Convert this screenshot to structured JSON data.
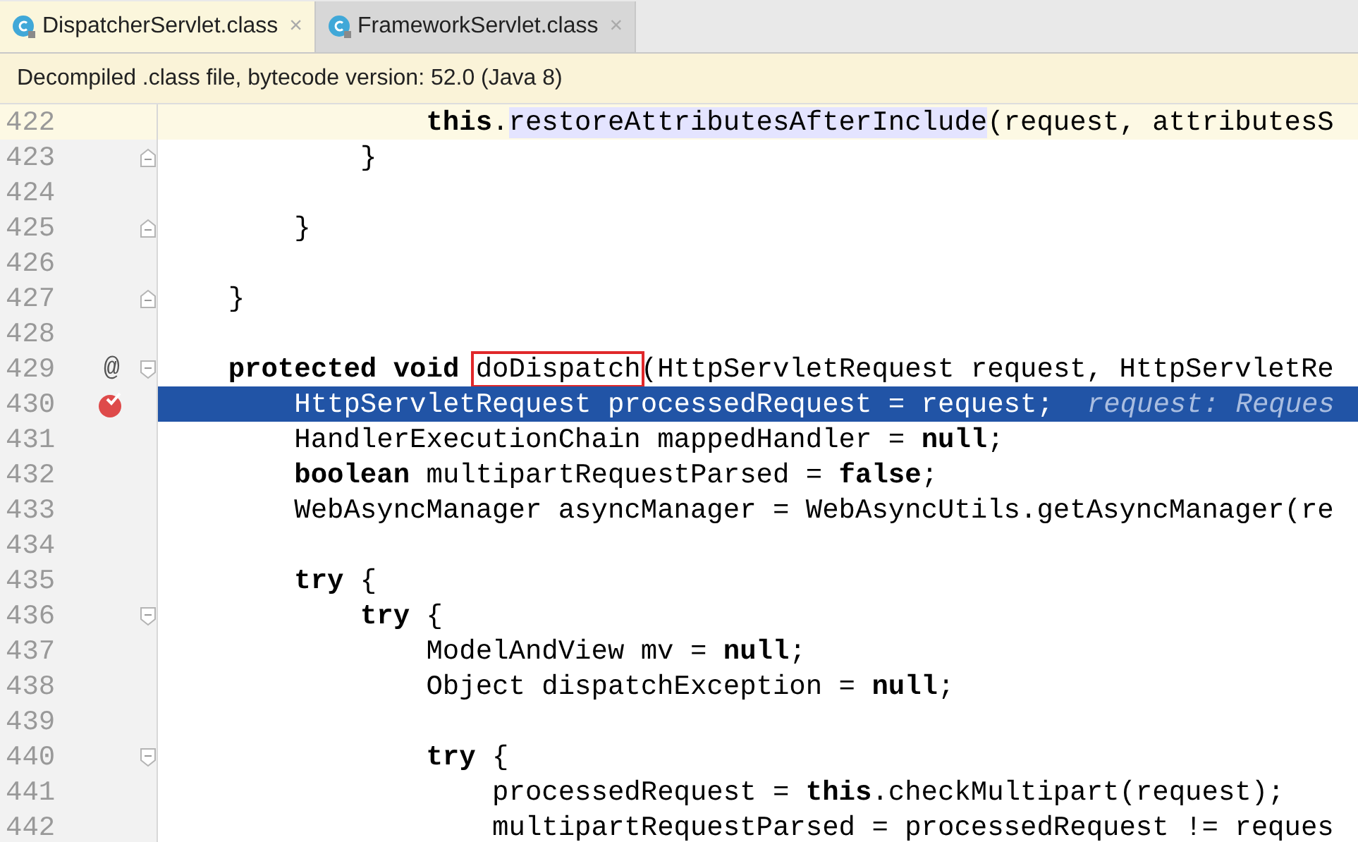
{
  "tabs": [
    {
      "label": "DispatcherServlet.class",
      "close": "×",
      "selected": true
    },
    {
      "label": "FrameworkServlet.class",
      "close": "×",
      "selected": false
    }
  ],
  "notice": "Decompiled .class file, bytecode version: 52.0 (Java 8)",
  "lines": [
    {
      "number": "422",
      "current": true,
      "selected": false,
      "parts": [
        {
          "text": "                **this**.",
          "kind": "plain"
        },
        {
          "text": "restoreAttributesAfterInclude",
          "kind": "usage"
        },
        {
          "text": "(request, attributesS",
          "kind": "plain"
        }
      ]
    },
    {
      "number": "423",
      "current": false,
      "selected": false,
      "fold": {
        "kind": "end"
      },
      "parts": [
        {
          "text": "            }",
          "kind": "plain"
        }
      ]
    },
    {
      "number": "424",
      "current": false,
      "selected": false
    },
    {
      "number": "425",
      "current": false,
      "selected": false,
      "fold": {
        "kind": "end"
      },
      "parts": [
        {
          "text": "        }",
          "kind": "plain"
        }
      ]
    },
    {
      "number": "426",
      "current": false,
      "selected": false
    },
    {
      "number": "427",
      "current": false,
      "selected": false,
      "fold": {
        "kind": "end"
      },
      "parts": [
        {
          "text": "    }",
          "kind": "plain"
        }
      ]
    },
    {
      "number": "428",
      "current": false,
      "selected": false
    },
    {
      "number": "429",
      "current": false,
      "selected": false,
      "marker": {
        "kind": "override",
        "symbol": "@"
      },
      "fold": {
        "kind": "start"
      },
      "parts": [
        {
          "text": "    **protected** **void** ",
          "kind": "plain"
        },
        {
          "text": "doDispatch",
          "kind": "boxed"
        },
        {
          "text": "(HttpServletRequest request, HttpServletRe",
          "kind": "plain"
        }
      ]
    },
    {
      "number": "430",
      "current": false,
      "selected": true,
      "marker": {
        "kind": "breakpoint"
      },
      "parts": [
        {
          "text": "        HttpServletRequest processedRequest = request;",
          "kind": "plain"
        }
      ],
      "hint": "request: Reques"
    },
    {
      "number": "431",
      "current": false,
      "selected": false,
      "parts": [
        {
          "text": "        HandlerExecutionChain mappedHandler = **null**;",
          "kind": "plain"
        }
      ]
    },
    {
      "number": "432",
      "current": false,
      "selected": false,
      "parts": [
        {
          "text": "        **boolean** multipartRequestParsed = **false**;",
          "kind": "plain"
        }
      ]
    },
    {
      "number": "433",
      "current": false,
      "selected": false,
      "parts": [
        {
          "text": "        WebAsyncManager asyncManager = WebAsyncUtils.getAsyncManager(re",
          "kind": "plain"
        }
      ]
    },
    {
      "number": "434",
      "current": false,
      "selected": false
    },
    {
      "number": "435",
      "current": false,
      "selected": false,
      "parts": [
        {
          "text": "        **try** {",
          "kind": "plain"
        }
      ]
    },
    {
      "number": "436",
      "current": false,
      "selected": false,
      "fold": {
        "kind": "start"
      },
      "parts": [
        {
          "text": "            **try** {",
          "kind": "plain"
        }
      ]
    },
    {
      "number": "437",
      "current": false,
      "selected": false,
      "parts": [
        {
          "text": "                ModelAndView mv = **null**;",
          "kind": "plain"
        }
      ]
    },
    {
      "number": "438",
      "current": false,
      "selected": false,
      "parts": [
        {
          "text": "                Object dispatchException = **null**;",
          "kind": "plain"
        }
      ]
    },
    {
      "number": "439",
      "current": false,
      "selected": false
    },
    {
      "number": "440",
      "current": false,
      "selected": false,
      "fold": {
        "kind": "start"
      },
      "parts": [
        {
          "text": "                **try** {",
          "kind": "plain"
        }
      ]
    },
    {
      "number": "441",
      "current": false,
      "selected": false,
      "parts": [
        {
          "text": "                    processedRequest = **this**.checkMultipart(request);",
          "kind": "plain"
        }
      ]
    },
    {
      "number": "442",
      "current": false,
      "selected": false,
      "parts": [
        {
          "text": "                    multipartRequestParsed = processedRequest != reques",
          "kind": "plain"
        }
      ]
    }
  ]
}
